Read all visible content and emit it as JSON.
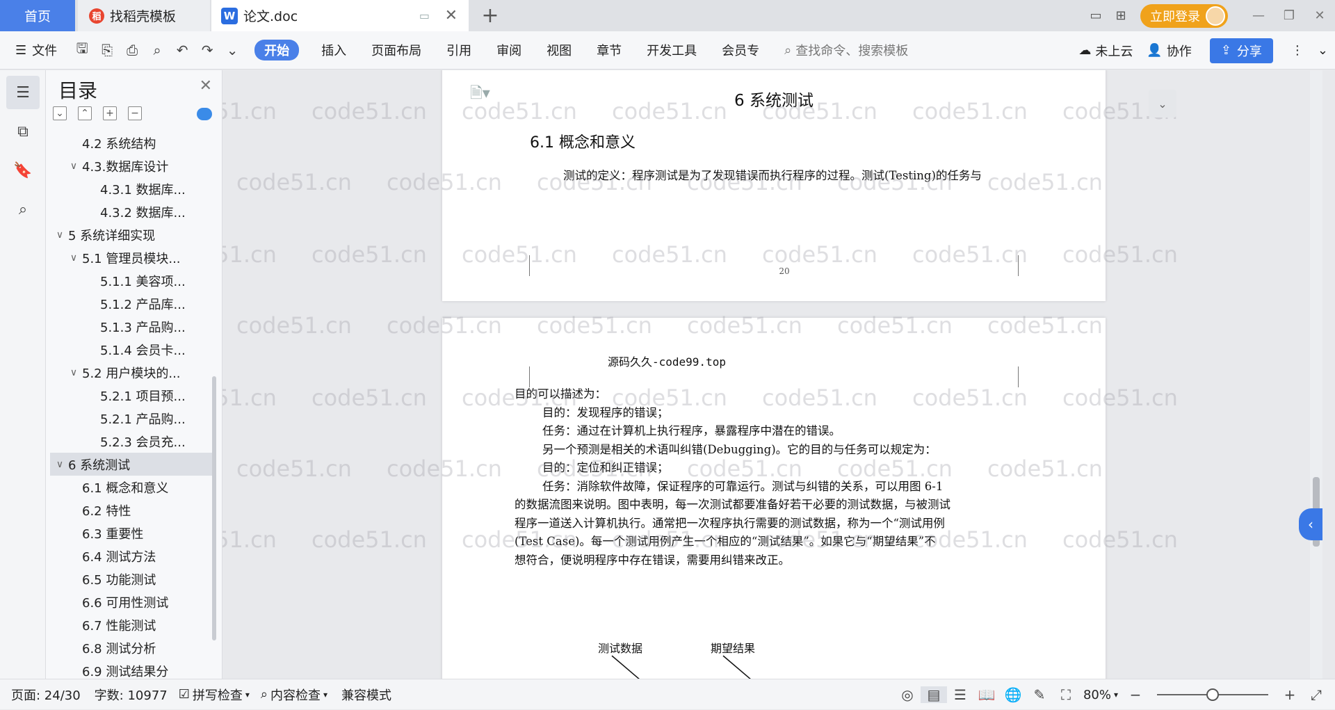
{
  "tabs": {
    "home": "首页",
    "docer": "找稻壳模板",
    "doc": "论文.doc"
  },
  "topbar": {
    "login": "立即登录"
  },
  "ribbon": {
    "file": "文件",
    "tabs": [
      "开始",
      "插入",
      "页面布局",
      "引用",
      "审阅",
      "视图",
      "章节",
      "开发工具",
      "会员专"
    ],
    "search_placeholder": "查找命令、搜索模板",
    "cloud": "未上云",
    "collab": "协作",
    "share": "分享"
  },
  "toc": {
    "title": "目录",
    "items": [
      {
        "label": "4.2 系统结构",
        "level": 2,
        "arrow": ""
      },
      {
        "label": "4.3.数据库设计",
        "level": 2,
        "arrow": "∨"
      },
      {
        "label": "4.3.1 数据库...",
        "level": 3,
        "arrow": ""
      },
      {
        "label": "4.3.2 数据库...",
        "level": 3,
        "arrow": ""
      },
      {
        "label": "5 系统详细实现",
        "level": 1,
        "arrow": "∨"
      },
      {
        "label": "5.1  管理员模块...",
        "level": 2,
        "arrow": "∨"
      },
      {
        "label": "5.1.1  美容项...",
        "level": 3,
        "arrow": ""
      },
      {
        "label": "5.1.2  产品库...",
        "level": 3,
        "arrow": ""
      },
      {
        "label": "5.1.3  产品购...",
        "level": 3,
        "arrow": ""
      },
      {
        "label": "5.1.4  会员卡...",
        "level": 3,
        "arrow": ""
      },
      {
        "label": "5.2  用户模块的...",
        "level": 2,
        "arrow": "∨"
      },
      {
        "label": "5.2.1  项目预...",
        "level": 3,
        "arrow": ""
      },
      {
        "label": "5.2.1  产品购...",
        "level": 3,
        "arrow": ""
      },
      {
        "label": "5.2.3  会员充...",
        "level": 3,
        "arrow": ""
      },
      {
        "label": "6 系统测试",
        "level": 1,
        "arrow": "∨",
        "selected": true
      },
      {
        "label": "6.1 概念和意义",
        "level": 2,
        "arrow": ""
      },
      {
        "label": "6.2 特性",
        "level": 2,
        "arrow": ""
      },
      {
        "label": "6.3 重要性",
        "level": 2,
        "arrow": ""
      },
      {
        "label": "6.4 测试方法",
        "level": 2,
        "arrow": ""
      },
      {
        "label": "6.5  功能测试",
        "level": 2,
        "arrow": ""
      },
      {
        "label": "6.6 可用性测试",
        "level": 2,
        "arrow": ""
      },
      {
        "label": "6.7 性能测试",
        "level": 2,
        "arrow": ""
      },
      {
        "label": "6.8 测试分析",
        "level": 2,
        "arrow": ""
      },
      {
        "label": "6.9 测试结果分",
        "level": 2,
        "arrow": ""
      }
    ]
  },
  "page1": {
    "chapter": "6 系统测试",
    "section": "6.1 概念和意义",
    "para": "测试的定义：程序测试是为了发现错误而执行程序的过程。测试(Testing)的任务与",
    "page_num": "20"
  },
  "page2": {
    "header": "源码久久-code99.top",
    "lines": [
      "目的可以描述为：",
      "目的：发现程序的错误；",
      "任务：通过在计算机上执行程序，暴露程序中潜在的错误。",
      "另一个预测是相关的术语叫纠错(Debugging)。它的目的与任务可以规定为：",
      "目的：定位和纠正错误；",
      "任务：消除软件故障，保证程序的可靠运行。测试与纠错的关系，可以用图 6-1",
      "的数据流图来说明。图中表明，每一次测试都要准备好若干必要的测试数据，与被测试",
      "程序一道送入计算机执行。通常把一次程序执行需要的测试数据，称为一个“测试用例",
      "(Test Case)。每一个测试用例产生一个相应的“测试结果”。如果它与“期望结果”不",
      "想符合，便说明程序中存在错误，需要用纠错来改正。"
    ],
    "diagram_labels": [
      "测试数据",
      "期望结果"
    ]
  },
  "watermark": "code51.cn",
  "status": {
    "page": "页面: 24/30",
    "words": "字数: 10977",
    "spell": "拼写检查",
    "content": "内容检查",
    "compat": "兼容模式",
    "zoom": "80%",
    "zoom_level": 0.5
  }
}
